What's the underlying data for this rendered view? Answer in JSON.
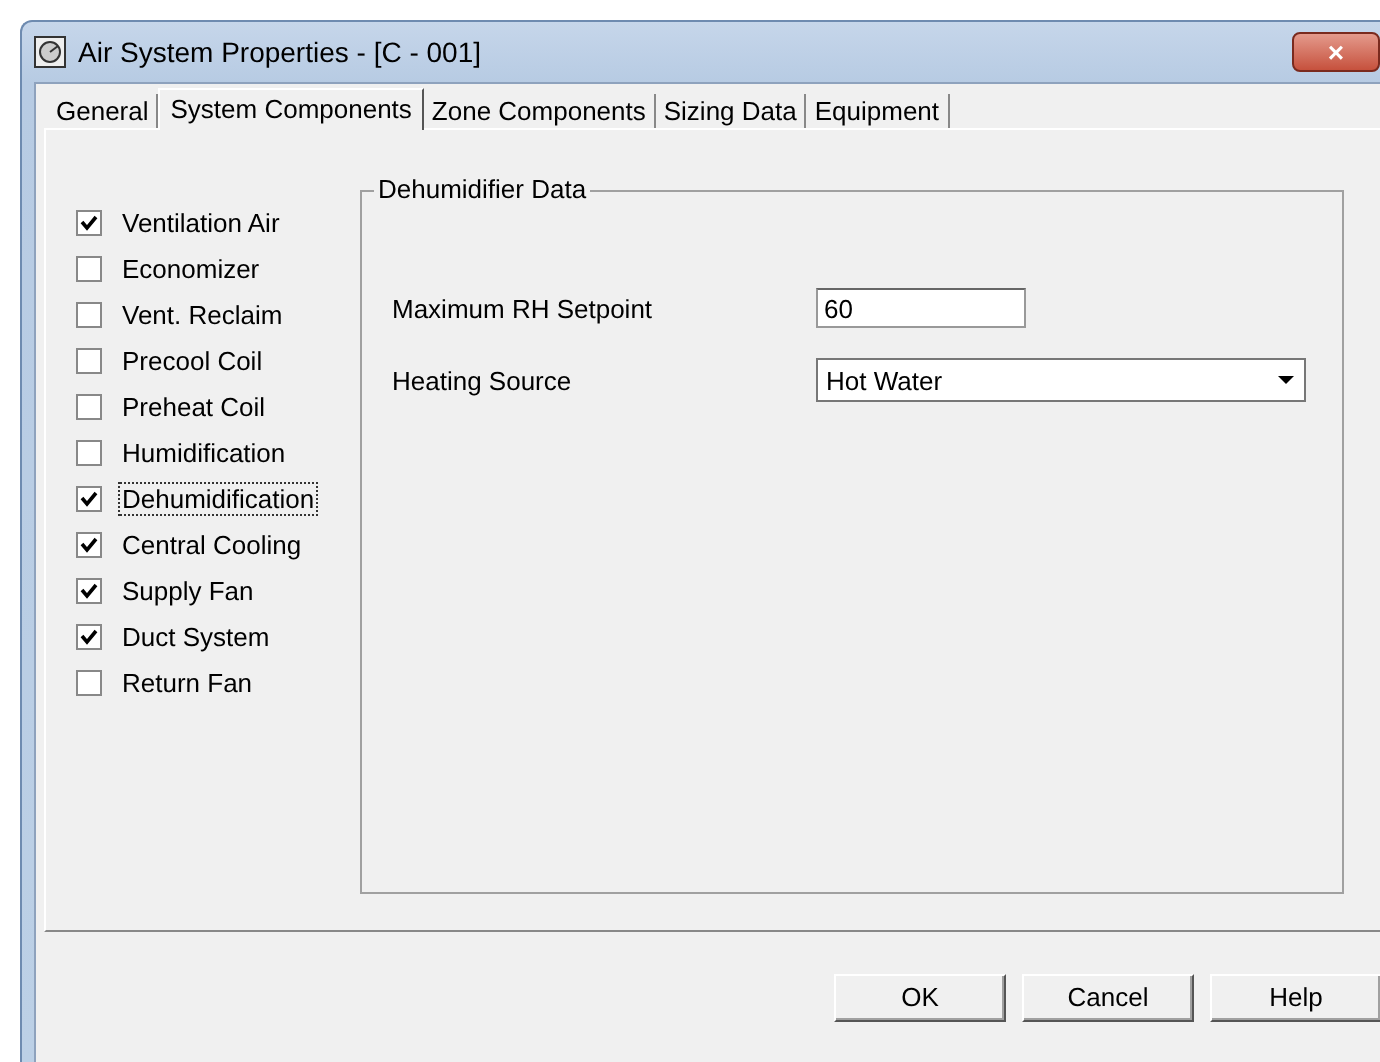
{
  "window": {
    "title": "Air System Properties - [C - 001]",
    "close": "×"
  },
  "tabs": [
    {
      "label": "General",
      "selected": false
    },
    {
      "label": "System Components",
      "selected": true
    },
    {
      "label": "Zone Components",
      "selected": false
    },
    {
      "label": "Sizing Data",
      "selected": false
    },
    {
      "label": "Equipment",
      "selected": false
    }
  ],
  "components": [
    {
      "label": "Ventilation Air",
      "checked": true,
      "focused": false
    },
    {
      "label": "Economizer",
      "checked": false,
      "focused": false
    },
    {
      "label": "Vent. Reclaim",
      "checked": false,
      "focused": false
    },
    {
      "label": "Precool Coil",
      "checked": false,
      "focused": false
    },
    {
      "label": "Preheat Coil",
      "checked": false,
      "focused": false
    },
    {
      "label": "Humidification",
      "checked": false,
      "focused": false
    },
    {
      "label": "Dehumidification",
      "checked": true,
      "focused": true
    },
    {
      "label": "Central Cooling",
      "checked": true,
      "focused": false
    },
    {
      "label": "Supply Fan",
      "checked": true,
      "focused": false
    },
    {
      "label": "Duct System",
      "checked": true,
      "focused": false
    },
    {
      "label": "Return Fan",
      "checked": false,
      "focused": false
    }
  ],
  "group": {
    "title": "Dehumidifier Data",
    "fields": [
      {
        "kind": "text",
        "label": "Maximum RH Setpoint",
        "value": "60"
      },
      {
        "kind": "select",
        "label": "Heating Source",
        "value": "Hot Water"
      }
    ]
  },
  "buttons": [
    "OK",
    "Cancel",
    "Help"
  ]
}
